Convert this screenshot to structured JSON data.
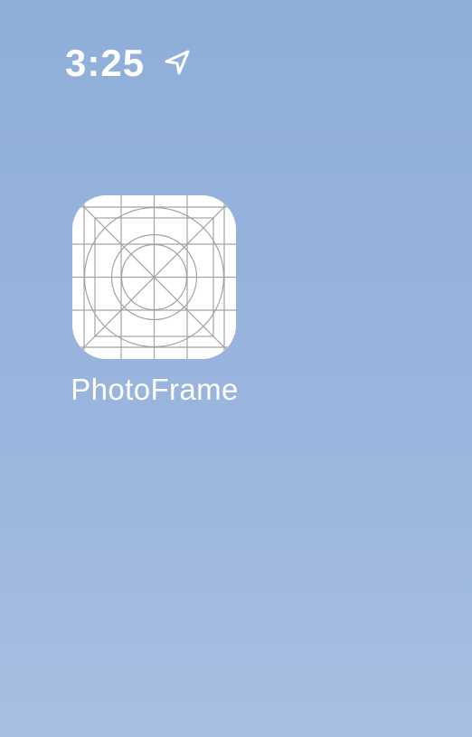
{
  "status_bar": {
    "time": "3:25",
    "location_icon": "location-arrow-icon"
  },
  "home_screen": {
    "apps": [
      {
        "label": "PhotoFrame",
        "icon": "app-icon-template-grid"
      }
    ]
  },
  "colors": {
    "wallpaper_top": "#8eaed8",
    "wallpaper_bottom": "#a8bfe2",
    "text": "#ffffff",
    "icon_background": "#ffffff",
    "icon_lines": "#a3a3a3"
  }
}
